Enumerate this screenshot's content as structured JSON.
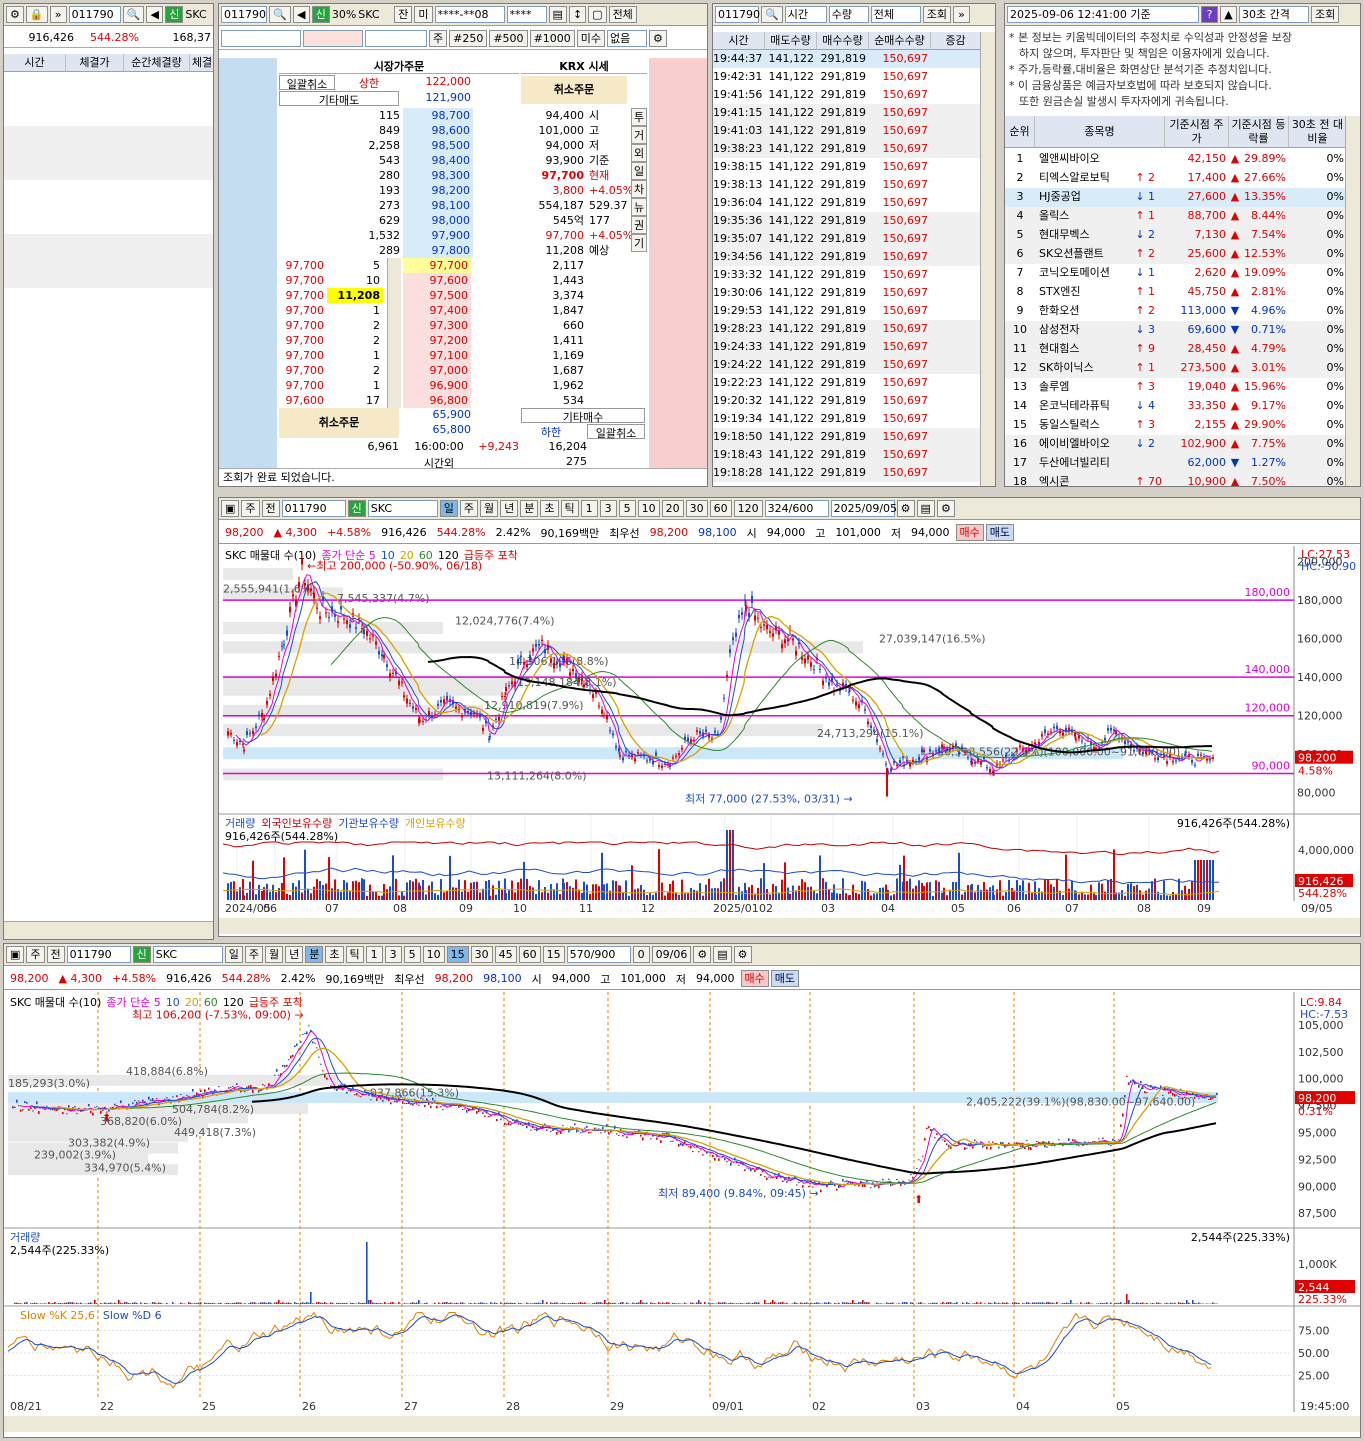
{
  "p1": {
    "code": "011790",
    "name": "SKC",
    "volume": "916,426",
    "rate": "544.28%",
    "partial": "168,37",
    "cols": [
      "시간",
      "체결가",
      "순간체결량",
      "체결"
    ]
  },
  "p2": {
    "code": "011790",
    "flag": "신",
    "pct": "30%",
    "name": "SKC",
    "jan": "잔",
    "mi": "미",
    "account": "****-**08",
    "pw": "****",
    "all": "전체",
    "ju": "주",
    "b250": "#250",
    "b500": "#500",
    "b1000": "#1000",
    "unfilled": "미수",
    "none": "없음",
    "title_left": "시장가주문",
    "title_right": "KRX 시세",
    "cancel_all": "일괄취소",
    "upper": "상한",
    "upper_price": "122,000",
    "other_sell": "기타매도",
    "other_sell_price": "121,900",
    "cancel_order": "취소주문",
    "other_buy": "기타매수",
    "lower": "하한",
    "cancel_all2": "일괄취소",
    "asks": [
      [
        "115",
        "98,700"
      ],
      [
        "849",
        "98,600"
      ],
      [
        "2,258",
        "98,500"
      ],
      [
        "543",
        "98,400"
      ],
      [
        "280",
        "98,300"
      ],
      [
        "193",
        "98,200"
      ],
      [
        "273",
        "98,100"
      ],
      [
        "629",
        "98,000"
      ],
      [
        "1,532",
        "97,900"
      ],
      [
        "289",
        "97,800"
      ]
    ],
    "bids": [
      [
        "97,700",
        "2,117"
      ],
      [
        "97,600",
        "1,443"
      ],
      [
        "97,500",
        "3,374"
      ],
      [
        "97,400",
        "1,847"
      ],
      [
        "97,300",
        "660"
      ],
      [
        "97,200",
        "1,411"
      ],
      [
        "97,100",
        "1,169"
      ],
      [
        "97,000",
        "1,687"
      ],
      [
        "96,900",
        "1,962"
      ],
      [
        "96,800",
        "534"
      ]
    ],
    "fills": [
      [
        "97,700",
        "5"
      ],
      [
        "97,700",
        "10"
      ],
      [
        "97,700",
        "11,208"
      ],
      [
        "97,700",
        "1"
      ],
      [
        "97,700",
        "2"
      ],
      [
        "97,700",
        "2"
      ],
      [
        "97,700",
        "1"
      ],
      [
        "97,700",
        "2"
      ],
      [
        "97,700",
        "1"
      ],
      [
        "97,600",
        "17"
      ]
    ],
    "info": [
      [
        "94,400",
        "시"
      ],
      [
        "101,000",
        "고"
      ],
      [
        "94,000",
        "저"
      ],
      [
        "93,900",
        "기준"
      ],
      [
        "97,700",
        "현재"
      ],
      [
        "3,800",
        "+4.05%"
      ],
      [
        "554,187",
        "529.37"
      ],
      [
        "545억",
        "177"
      ],
      [
        "97,700",
        "+4.05%"
      ],
      [
        "11,208",
        "예상"
      ]
    ],
    "side_tabs": [
      "투",
      "거",
      "외",
      "일",
      "차",
      "뉴",
      "권",
      "기"
    ],
    "low1": "65,900",
    "low2": "65,800",
    "total_left": "6,961",
    "time": "16:00:00",
    "diff": "+9,243",
    "total_right": "16,204",
    "after": "시간외",
    "after_val": "275",
    "status": "조회가 완료 되었습니다."
  },
  "p3": {
    "code": "011790",
    "f1": "시간",
    "f2": "수량",
    "f3": "전체",
    "btn": "조회",
    "cols": [
      "시간",
      "매도수량",
      "매수수량",
      "순매수수량",
      "증감"
    ],
    "times": [
      "19:44:37",
      "19:42:31",
      "19:41:56",
      "19:41:15",
      "19:41:03",
      "19:38:23",
      "19:38:15",
      "19:38:13",
      "19:36:04",
      "19:35:36",
      "19:35:07",
      "19:34:56",
      "19:33:32",
      "19:30:06",
      "19:29:53",
      "19:28:23",
      "19:24:33",
      "19:24:22",
      "19:22:23",
      "19:20:32",
      "19:19:34",
      "19:18:50",
      "19:18:43",
      "19:18:28"
    ],
    "sell": "141,122",
    "buy": "291,819",
    "net": "150,697"
  },
  "p4": {
    "datetime": "2025-09-06 12:41:00 기준",
    "interval": "30초 간격",
    "btn": "조회",
    "notes": [
      "* 본 정보는 키움빅데이터의 추정치로 수익성과 안정성을 보장",
      "하지 않으며, 투자판단 및 책임은 이용자에게 있습니다.",
      "* 주가,등락률,대비율은 화면상단 분석기준 추정치입니다.",
      "* 이 금융상품은 예금자보호법에 따라 보호되지 않습니다.",
      "또한 원금손실 발생시 투자자에게 귀속됩니다."
    ],
    "cols": [
      "순위",
      "종목명",
      "기준시점 주가",
      "기준시점 등락률",
      "30초 전 대비율"
    ],
    "rows": [
      [
        "1",
        "엘앤씨바이오",
        "",
        "",
        "42,150",
        "29.89%",
        "0%",
        "up"
      ],
      [
        "2",
        "티엑스알로보틱",
        "↑",
        "2",
        "17,400",
        "27.66%",
        "0%",
        "up"
      ],
      [
        "3",
        "HJ중공업",
        "↓",
        "1",
        "27,600",
        "13.35%",
        "0%",
        "up"
      ],
      [
        "4",
        "올릭스",
        "↑",
        "1",
        "88,700",
        "8.44%",
        "0%",
        "up"
      ],
      [
        "5",
        "현대무벡스",
        "↓",
        "2",
        "7,130",
        "7.54%",
        "0%",
        "up"
      ],
      [
        "6",
        "SK오션플랜트",
        "↑",
        "2",
        "25,600",
        "12.53%",
        "0%",
        "up"
      ],
      [
        "7",
        "코닉오토메이션",
        "↓",
        "1",
        "2,620",
        "19.09%",
        "0%",
        "up"
      ],
      [
        "8",
        "STX엔진",
        "↑",
        "1",
        "45,750",
        "2.81%",
        "0%",
        "up"
      ],
      [
        "9",
        "한화오션",
        "↑",
        "2",
        "113,000",
        "4.96%",
        "0%",
        "dn"
      ],
      [
        "10",
        "삼성전자",
        "↓",
        "3",
        "69,600",
        "0.71%",
        "0%",
        "dn"
      ],
      [
        "11",
        "현대힘스",
        "↑",
        "9",
        "28,450",
        "4.79%",
        "0%",
        "up"
      ],
      [
        "12",
        "SK하이닉스",
        "↑",
        "1",
        "273,500",
        "3.01%",
        "0%",
        "up"
      ],
      [
        "13",
        "솔루엠",
        "↑",
        "3",
        "19,040",
        "15.96%",
        "0%",
        "up"
      ],
      [
        "14",
        "온코닉테라퓨틱",
        "↓",
        "4",
        "33,350",
        "9.17%",
        "0%",
        "up"
      ],
      [
        "15",
        "동일스틸럭스",
        "↑",
        "3",
        "2,155",
        "29.90%",
        "0%",
        "up"
      ],
      [
        "16",
        "에이비엘바이오",
        "↓",
        "2",
        "102,900",
        "7.75%",
        "0%",
        "up"
      ],
      [
        "17",
        "두산에너빌리티",
        "",
        "",
        "62,000",
        "1.27%",
        "0%",
        "dn"
      ],
      [
        "18",
        "엑시콘",
        "↑",
        "70",
        "10,900",
        "7.50%",
        "0%",
        "up"
      ]
    ]
  },
  "c1": {
    "tb": [
      "주",
      "전",
      "011790",
      "신",
      "SKC",
      "일",
      "주",
      "월",
      "년",
      "분",
      "초",
      "틱",
      "1",
      "3",
      "5",
      "10",
      "20",
      "30",
      "60",
      "120",
      "324/600",
      "2025/09/05"
    ],
    "quote": [
      "98,200",
      "4,300",
      "+4.58%",
      "916,426",
      "544.28%",
      "2.42%",
      "90,169백만",
      "최우선",
      "98,200",
      "98,100",
      "시",
      "94,000",
      "고",
      "101,000",
      "저",
      "94,000",
      "매수",
      "매도"
    ],
    "legend": [
      "SKC 매물대 수(10)",
      "종가 단순 5",
      "10",
      "20",
      "60",
      "120",
      "급등주 포착"
    ],
    "hl": [
      "LC:27.53",
      "HC:-50.90"
    ],
    "yticks": [
      "200,000",
      "180,000",
      "160,000",
      "140,000",
      "120,000",
      "100,000",
      "80,000"
    ],
    "hlines": [
      "180,000",
      "140,000",
      "120,000",
      "90,000"
    ],
    "high": "최고 200,000 (-50.90%, 06/18)",
    "low": "최저 77,000 (27.53%, 03/31)",
    "vp": [
      "2,555,941(1.6%)",
      "7,545,337(4.7%)",
      "12,024,776(7.4%)",
      "27,039,147(16.5%)",
      "14,306,196(8.8%)",
      "13,148,184(8.1%)",
      "12,910,819(7.9%)",
      "24,713,294(15.1%)",
      "36,393,556(22.3%)(100,000.00~91,000.00)",
      "13,111,264(8.0%)"
    ],
    "price_tag": "98,200",
    "pct_tag": "4.58%",
    "vol_legend": [
      "거래량",
      "외국인보유수량",
      "기관보유수량",
      "개인보유수량"
    ],
    "vol_left": "916,426주(544.28%)",
    "vol_right": "916,426주(544.28%)",
    "vol_ytick": "4,000,000",
    "vol_tag": "916,426",
    "vol_tag2": "544.28%",
    "xticks": [
      "2024/05",
      "06",
      "07",
      "08",
      "09",
      "10",
      "11",
      "12",
      "2025/01",
      "02",
      "03",
      "04",
      "05",
      "06",
      "07",
      "08",
      "09"
    ],
    "xend": "09/05"
  },
  "c2": {
    "tb": [
      "주",
      "전",
      "011790",
      "신",
      "SKC",
      "일",
      "주",
      "월",
      "년",
      "분",
      "초",
      "틱",
      "1",
      "3",
      "5",
      "10",
      "15",
      "30",
      "45",
      "60",
      "15",
      "570/900",
      "0",
      "09/06"
    ],
    "quote": [
      "98,200",
      "4,300",
      "+4.58%",
      "916,426",
      "544.28%",
      "2.42%",
      "90,169백만",
      "최우선",
      "98,200",
      "98,100",
      "시",
      "94,000",
      "고",
      "101,000",
      "저",
      "94,000",
      "매수",
      "매도"
    ],
    "legend": [
      "SKC 매물대 수(10)",
      "종가 단순 5",
      "10",
      "20",
      "60",
      "120",
      "급등주 포착"
    ],
    "hl": [
      "LC:9.84",
      "HC:-7.53"
    ],
    "yticks": [
      "105,000",
      "102,500",
      "100,000",
      "97,500",
      "95,000",
      "92,500",
      "90,000",
      "87,500"
    ],
    "high": "최고 106,200 (-7.53%, 09:00)",
    "low": "최저 89,400 (9.84%, 09:45)",
    "vp": [
      "418,884(6.8%)",
      "185,293(3.0%)",
      "937,866(15.3%)",
      "504,784(8.2%)",
      "368,820(6.0%)",
      "449,418(7.3%)",
      "303,382(4.9%)",
      "239,002(3.9%)",
      "334,970(5.4%)",
      "2,405,222(39.1%)(98,830.00~97,640.00)"
    ],
    "price_tag": "98,200",
    "pct_tag": "0.31%",
    "vol_legend": "거래량",
    "vol_left": "2,544주(225.33%)",
    "vol_right": "2,544주(225.33%)",
    "vol_ytick": "1,000K",
    "vol_tag": "2,544",
    "vol_tag2": "225.33%",
    "stoch_legend": [
      "Slow %K 25,6",
      "Slow %D 6"
    ],
    "stoch_ticks": [
      "75.00",
      "50.00",
      "25.00"
    ],
    "xticks": [
      "08/21",
      "22",
      "25",
      "26",
      "27",
      "28",
      "29",
      "09/01",
      "02",
      "03",
      "04",
      "05"
    ],
    "xend": "19:45:00"
  }
}
